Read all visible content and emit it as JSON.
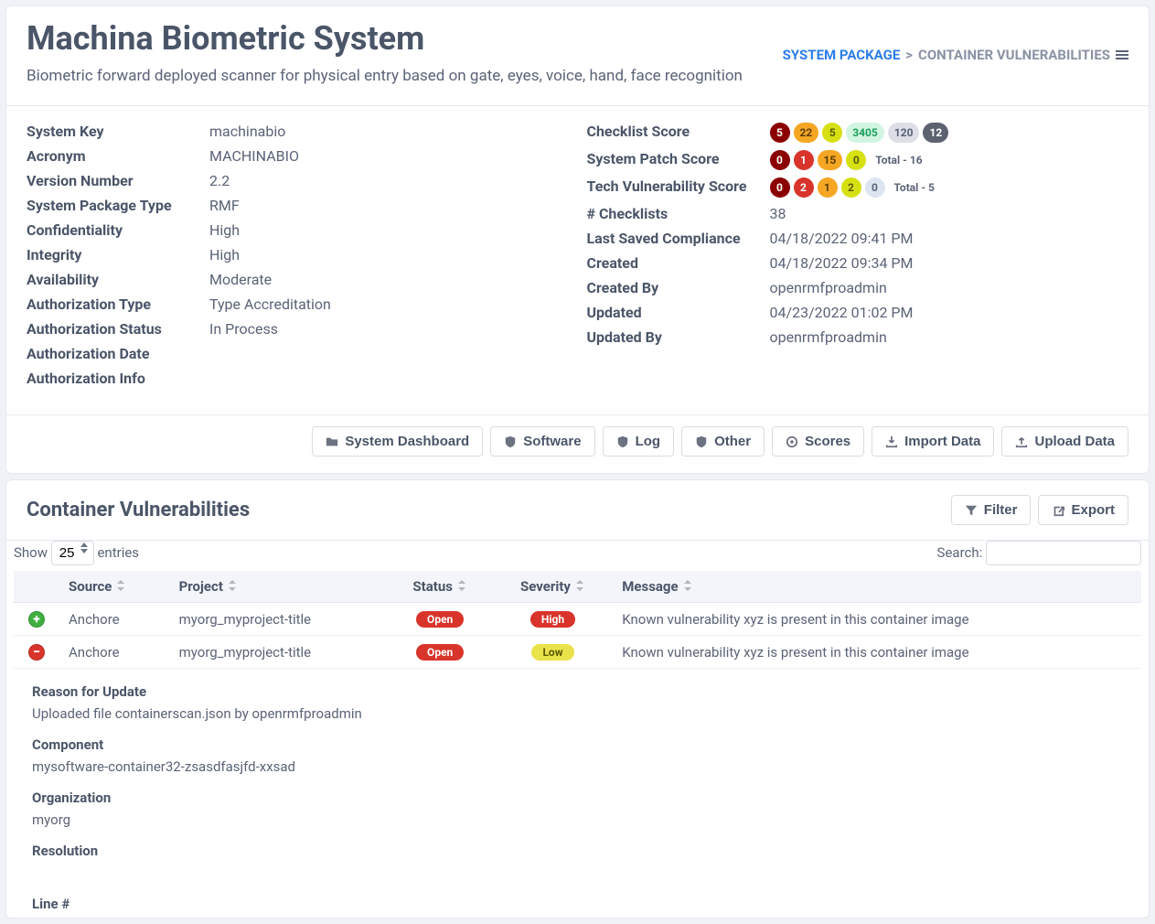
{
  "breadcrumb": {
    "root": "SYSTEM PACKAGE",
    "sep": ">",
    "current": "CONTAINER VULNERABILITIES"
  },
  "header": {
    "title": "Machina Biometric System",
    "subtitle": "Biometric forward deployed scanner for physical entry based on gate, eyes, voice, hand, face recognition"
  },
  "left_details": [
    {
      "label": "System Key",
      "value": "machinabio"
    },
    {
      "label": "Acronym",
      "value": "MACHINABIO"
    },
    {
      "label": "Version Number",
      "value": "2.2"
    },
    {
      "label": "System Package Type",
      "value": "RMF"
    },
    {
      "label": "Confidentiality",
      "value": "High"
    },
    {
      "label": "Integrity",
      "value": "High"
    },
    {
      "label": "Availability",
      "value": "Moderate"
    },
    {
      "label": "Authorization Type",
      "value": "Type Accreditation"
    },
    {
      "label": "Authorization Status",
      "value": "In Process"
    },
    {
      "label": "Authorization Date",
      "value": ""
    },
    {
      "label": "Authorization Info",
      "value": ""
    }
  ],
  "right_details": {
    "checklist_score_label": "Checklist Score",
    "checklist_score": [
      {
        "v": "5",
        "c": "b-darkred"
      },
      {
        "v": "22",
        "c": "b-orange"
      },
      {
        "v": "5",
        "c": "b-yellow"
      },
      {
        "v": "3405",
        "c": "b-green"
      },
      {
        "v": "120",
        "c": "b-grey"
      },
      {
        "v": "12",
        "c": "b-dark"
      }
    ],
    "patch_score_label": "System Patch Score",
    "patch_score": [
      {
        "v": "0",
        "c": "b-darkred"
      },
      {
        "v": "1",
        "c": "b-red"
      },
      {
        "v": "15",
        "c": "b-orange"
      },
      {
        "v": "0",
        "c": "b-yellow"
      }
    ],
    "patch_total": "Total - 16",
    "tech_score_label": "Tech Vulnerability Score",
    "tech_score": [
      {
        "v": "0",
        "c": "b-darkred"
      },
      {
        "v": "2",
        "c": "b-red"
      },
      {
        "v": "1",
        "c": "b-orange"
      },
      {
        "v": "2",
        "c": "b-yellow"
      },
      {
        "v": "0",
        "c": "b-lightblue"
      }
    ],
    "tech_total": "Total - 5",
    "plain": [
      {
        "label": "# Checklists",
        "value": "38"
      },
      {
        "label": "Last Saved Compliance",
        "value": "04/18/2022 09:41 PM"
      },
      {
        "label": "Created",
        "value": "04/18/2022 09:34 PM"
      },
      {
        "label": "Created By",
        "value": "openrmfproadmin"
      },
      {
        "label": "Updated",
        "value": "04/23/2022 01:02 PM"
      },
      {
        "label": "Updated By",
        "value": "openrmfproadmin"
      }
    ]
  },
  "toolbar": [
    {
      "key": "dashboard",
      "label": "System Dashboard",
      "icon": "folder"
    },
    {
      "key": "software",
      "label": "Software",
      "icon": "shield"
    },
    {
      "key": "log",
      "label": "Log",
      "icon": "shield"
    },
    {
      "key": "other",
      "label": "Other",
      "icon": "shield"
    },
    {
      "key": "scores",
      "label": "Scores",
      "icon": "target"
    },
    {
      "key": "import",
      "label": "Import Data",
      "icon": "import"
    },
    {
      "key": "upload",
      "label": "Upload Data",
      "icon": "upload"
    }
  ],
  "section": {
    "title": "Container Vulnerabilities",
    "filter": "Filter",
    "export": "Export"
  },
  "table": {
    "show_label": "Show",
    "entries_label": "entries",
    "page_size": "25",
    "search_label": "Search:",
    "columns": [
      "",
      "Source",
      "Project",
      "Status",
      "Severity",
      "Message"
    ],
    "rows": [
      {
        "icon": "plus",
        "source": "Anchore",
        "project": "myorg_myproject-title",
        "status": "Open",
        "severity": "High",
        "message": "Known vulnerability xyz is present in this container image"
      },
      {
        "icon": "minus",
        "source": "Anchore",
        "project": "myorg_myproject-title",
        "status": "Open",
        "severity": "Low",
        "message": "Known vulnerability xyz is present in this container image"
      }
    ]
  },
  "expanded": {
    "reason_label": "Reason for Update",
    "reason_value": "Uploaded file containerscan.json by openrmfproadmin",
    "component_label": "Component",
    "component_value": "mysoftware-container32-zsasdfasjfd-xxsad",
    "org_label": "Organization",
    "org_value": "myorg",
    "resolution_label": "Resolution",
    "line_label": "Line #"
  }
}
